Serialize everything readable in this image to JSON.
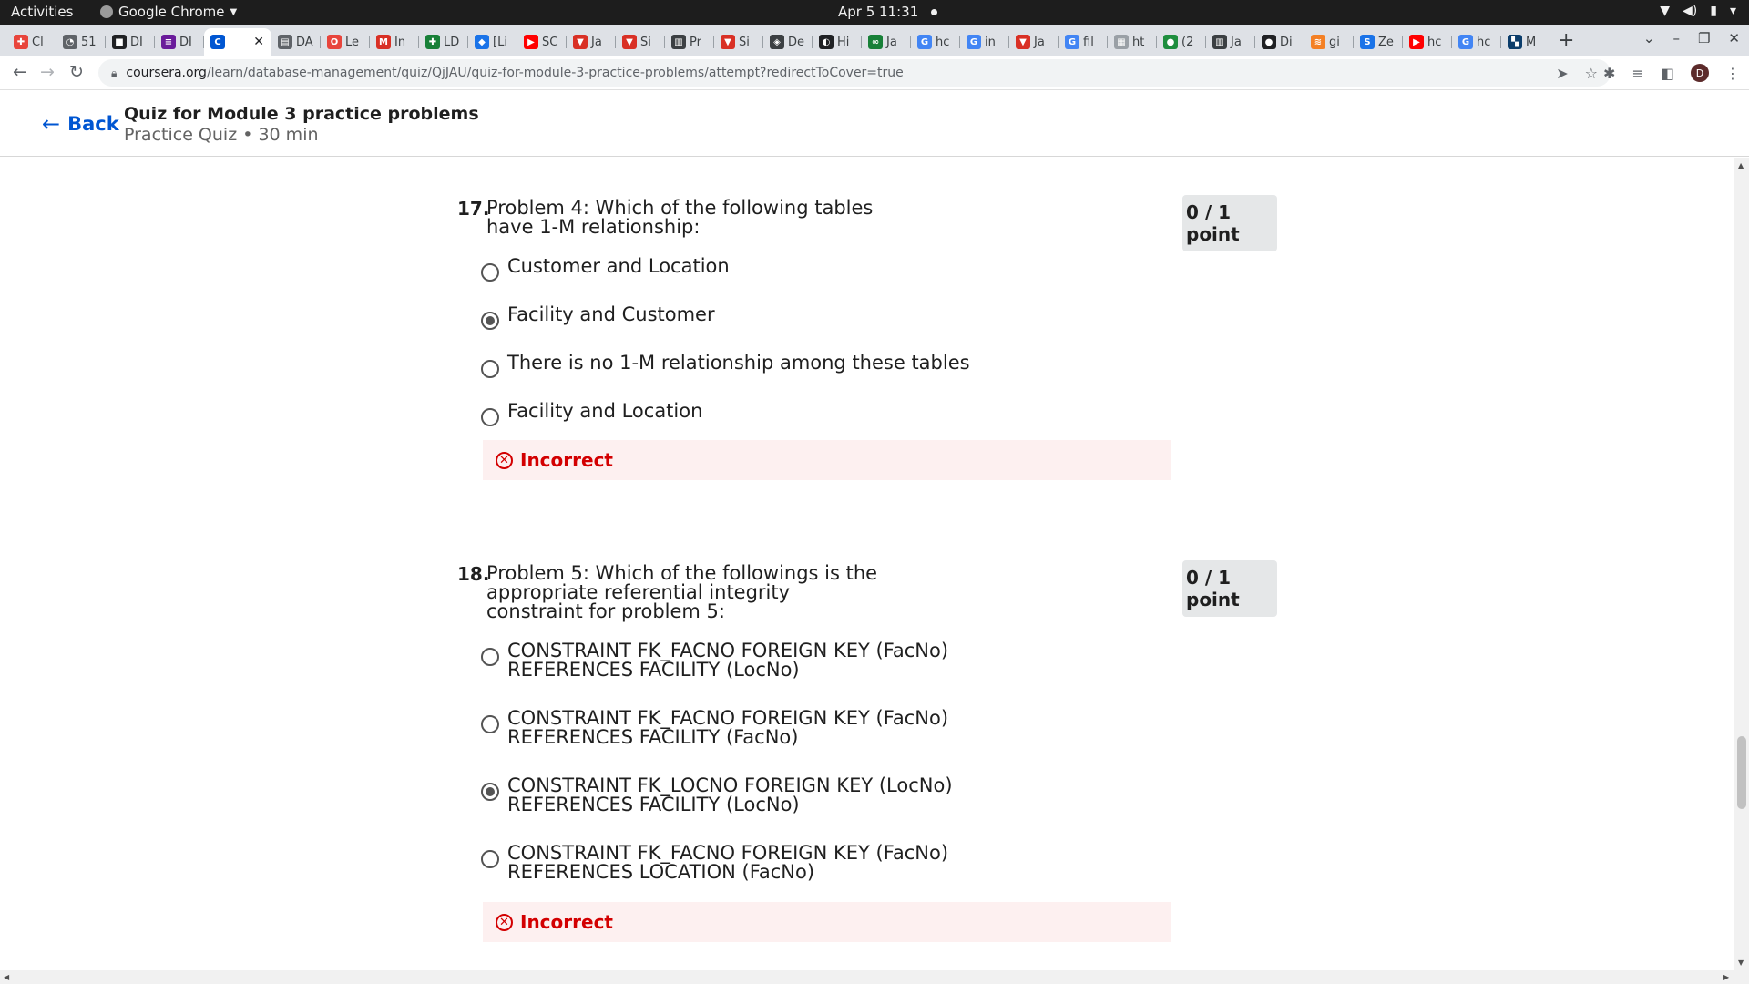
{
  "system_bar": {
    "activities": "Activities",
    "app_name": "Google Chrome",
    "clock": "Apr 5  11:31"
  },
  "browser": {
    "tabs": [
      {
        "label": "Cl",
        "color": "#e8453c",
        "glyph": "✚"
      },
      {
        "label": "51",
        "color": "#5f6368",
        "glyph": "◔"
      },
      {
        "label": "DI",
        "color": "#202124",
        "glyph": "■"
      },
      {
        "label": "DI",
        "color": "#6a1b9a",
        "glyph": "≡"
      },
      {
        "label": "",
        "color": "#0056d2",
        "glyph": "C",
        "active": true
      },
      {
        "label": "DA",
        "color": "#5f6368",
        "glyph": "▤"
      },
      {
        "label": "Le",
        "color": "#e8453c",
        "glyph": "O"
      },
      {
        "label": "In",
        "color": "#d93025",
        "glyph": "M"
      },
      {
        "label": "LD",
        "color": "#188038",
        "glyph": "✚"
      },
      {
        "label": "[Li",
        "color": "#1a73e8",
        "glyph": "◆"
      },
      {
        "label": "SC",
        "color": "#ff0000",
        "glyph": "▶"
      },
      {
        "label": "Ja",
        "color": "#d93025",
        "glyph": "▼"
      },
      {
        "label": "Si",
        "color": "#d93025",
        "glyph": "▼"
      },
      {
        "label": "Pr",
        "color": "#3c4043",
        "glyph": "▥"
      },
      {
        "label": "Si",
        "color": "#d93025",
        "glyph": "▼"
      },
      {
        "label": "De",
        "color": "#3c4043",
        "glyph": "◈"
      },
      {
        "label": "Hi",
        "color": "#202124",
        "glyph": "◐"
      },
      {
        "label": "Ja",
        "color": "#188038",
        "glyph": "∞"
      },
      {
        "label": "hc",
        "color": "#4285f4",
        "glyph": "G"
      },
      {
        "label": "in",
        "color": "#4285f4",
        "glyph": "G"
      },
      {
        "label": "Ja",
        "color": "#d93025",
        "glyph": "▼"
      },
      {
        "label": "fil",
        "color": "#4285f4",
        "glyph": "G"
      },
      {
        "label": "ht",
        "color": "#9aa0a6",
        "glyph": "▦"
      },
      {
        "label": "(2",
        "color": "#1e8e3e",
        "glyph": "●"
      },
      {
        "label": "Ja",
        "color": "#3c4043",
        "glyph": "▥"
      },
      {
        "label": "Di",
        "color": "#202124",
        "glyph": "●"
      },
      {
        "label": "gi",
        "color": "#f48024",
        "glyph": "≋"
      },
      {
        "label": "Ze",
        "color": "#1a73e8",
        "glyph": "S"
      },
      {
        "label": "hc",
        "color": "#ff0000",
        "glyph": "▶"
      },
      {
        "label": "hc",
        "color": "#4285f4",
        "glyph": "G"
      },
      {
        "label": "M",
        "color": "#0b3d6b",
        "glyph": "▚"
      }
    ],
    "new_tab": "+",
    "url_domain": "coursera.org",
    "url_path": "/learn/database-management/quiz/QjJAU/quiz-for-module-3-practice-problems/attempt?redirectToCover=true",
    "avatar_letter": "D"
  },
  "header": {
    "back_label": "Back",
    "title": "Quiz for Module 3 practice problems",
    "meta": "Practice Quiz • 30 min"
  },
  "questions": [
    {
      "number": "17.",
      "text": "Problem 4: Which of the following tables have 1-M relationship:",
      "points": "0 / 1 point",
      "options": [
        {
          "label": "Customer and Location",
          "selected": false
        },
        {
          "label": "Facility and Customer",
          "selected": true
        },
        {
          "label": "There is no 1-M relationship among these tables",
          "selected": false
        },
        {
          "label": "Facility and Location",
          "selected": false
        }
      ],
      "feedback": "Incorrect"
    },
    {
      "number": "18.",
      "text": "Problem 5: Which of the followings is the appropriate referential integrity constraint for problem 5:",
      "points": "0 / 1 point",
      "options": [
        {
          "label": "CONSTRAINT FK_FACNO FOREIGN KEY (FacNo) REFERENCES FACILITY (LocNo)",
          "selected": false
        },
        {
          "label": "CONSTRAINT FK_FACNO FOREIGN KEY (FacNo) REFERENCES FACILITY (FacNo)",
          "selected": false
        },
        {
          "label": "CONSTRAINT FK_LOCNO FOREIGN KEY (LocNo) REFERENCES FACILITY (LocNo)",
          "selected": true
        },
        {
          "label": "CONSTRAINT FK_FACNO FOREIGN KEY (FacNo) REFERENCES LOCATION (FacNo)",
          "selected": false
        }
      ],
      "feedback": "Incorrect"
    }
  ]
}
